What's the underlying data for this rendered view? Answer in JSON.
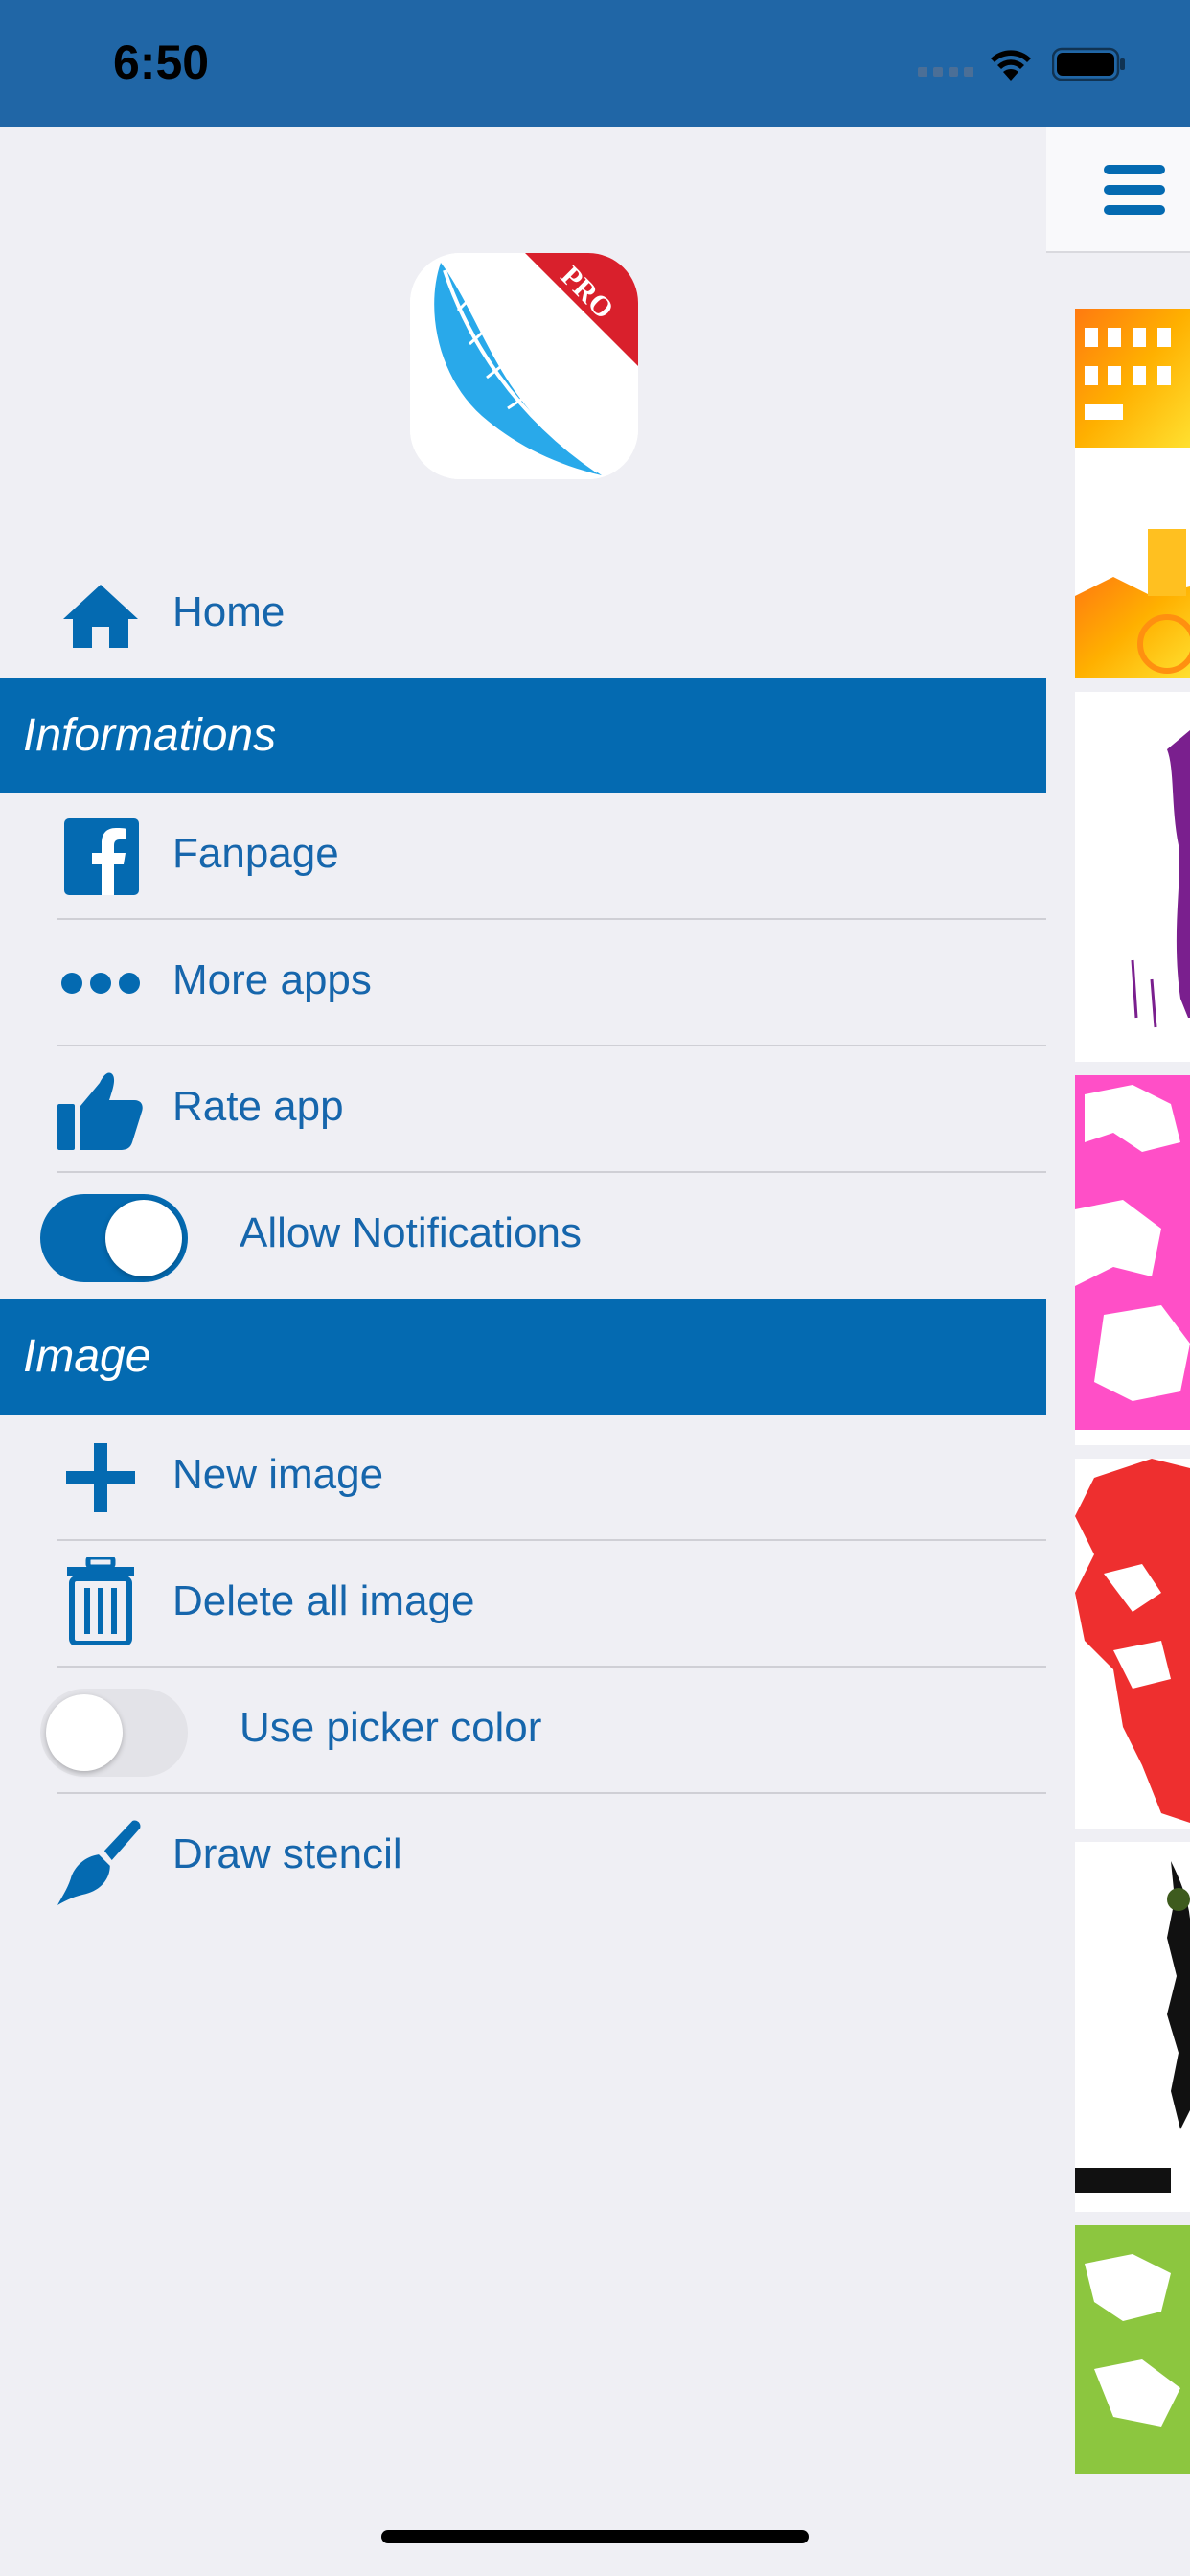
{
  "status_bar": {
    "time": "6:50"
  },
  "menu": {
    "home_label": "Home",
    "sections": [
      {
        "title": "Informations"
      },
      {
        "title": "Image"
      }
    ],
    "informations": {
      "fanpage": "Fanpage",
      "more_apps": "More apps",
      "rate_app": "Rate app",
      "allow_notifications": {
        "label": "Allow Notifications",
        "on": true
      }
    },
    "image": {
      "new_image": "New image",
      "delete_all": "Delete all image",
      "use_picker_color": {
        "label": "Use picker color",
        "on": false
      },
      "draw_stencil": "Draw stencil"
    }
  },
  "logo": {
    "badge_text": "PRO"
  },
  "colors": {
    "status_bar": "#2066a6",
    "accent": "#046ab1",
    "label": "#1666ac",
    "background": "#efeff4"
  },
  "icons": [
    "home-icon",
    "facebook-icon",
    "more-dots-icon",
    "thumbs-up-icon",
    "plus-icon",
    "trash-icon",
    "brush-icon",
    "hamburger-menu-icon",
    "feather-icon"
  ]
}
